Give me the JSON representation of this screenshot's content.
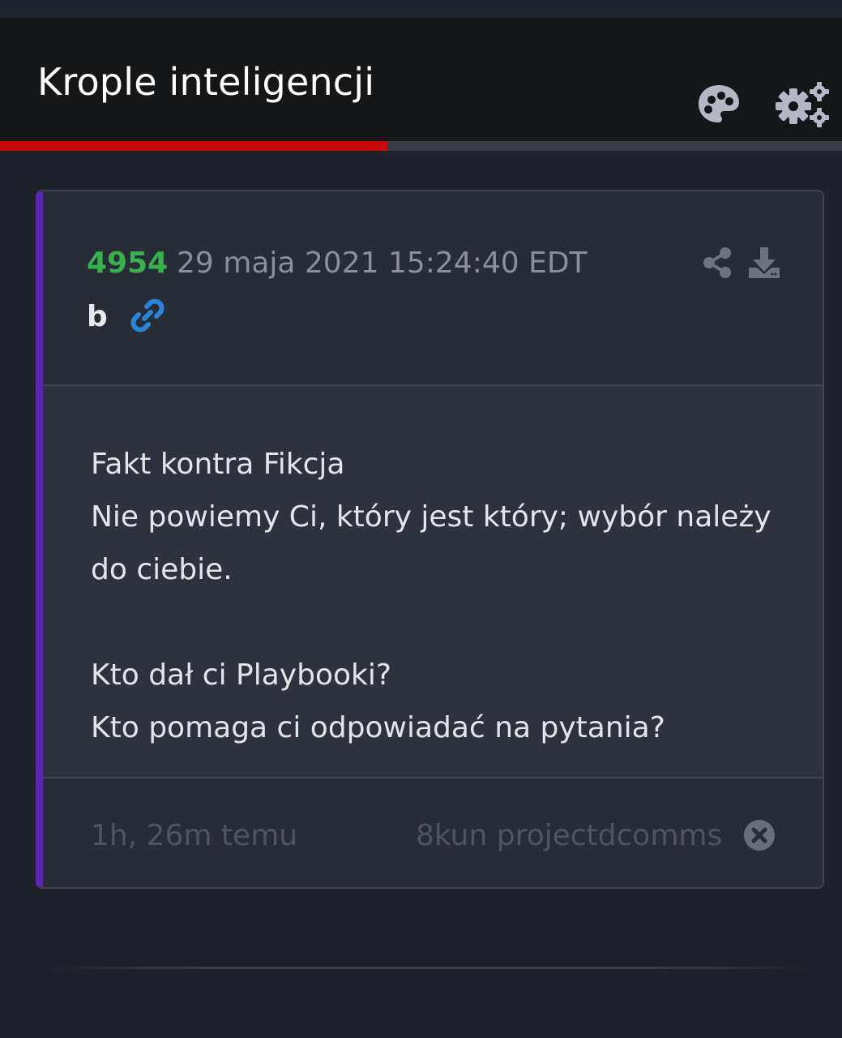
{
  "header": {
    "title": "Krople inteligencji",
    "icons": [
      "palette-icon",
      "gears-icon"
    ]
  },
  "progress": {
    "fraction": 0.46,
    "fill_color": "#c90a0a"
  },
  "post": {
    "number": "4954",
    "date": "29 maja 2021 15:24:40 EDT",
    "board": "b",
    "accent_color": "#5a24b4",
    "number_color": "#36b24b",
    "body": {
      "line1": "Fakt kontra Fikcja",
      "line2": "Nie powiemy Ci, który jest który; wybór należy do ciebie.",
      "line3": "Kto dał ci Playbooki?",
      "line4": "Kto pomaga ci odpowiadać na pytania?"
    },
    "footer": {
      "time_ago": "1h, 26m temu",
      "source": "8kun projectdcomms"
    },
    "icons": [
      "share-icon",
      "download-icon",
      "link-icon",
      "close-circle-icon"
    ]
  }
}
